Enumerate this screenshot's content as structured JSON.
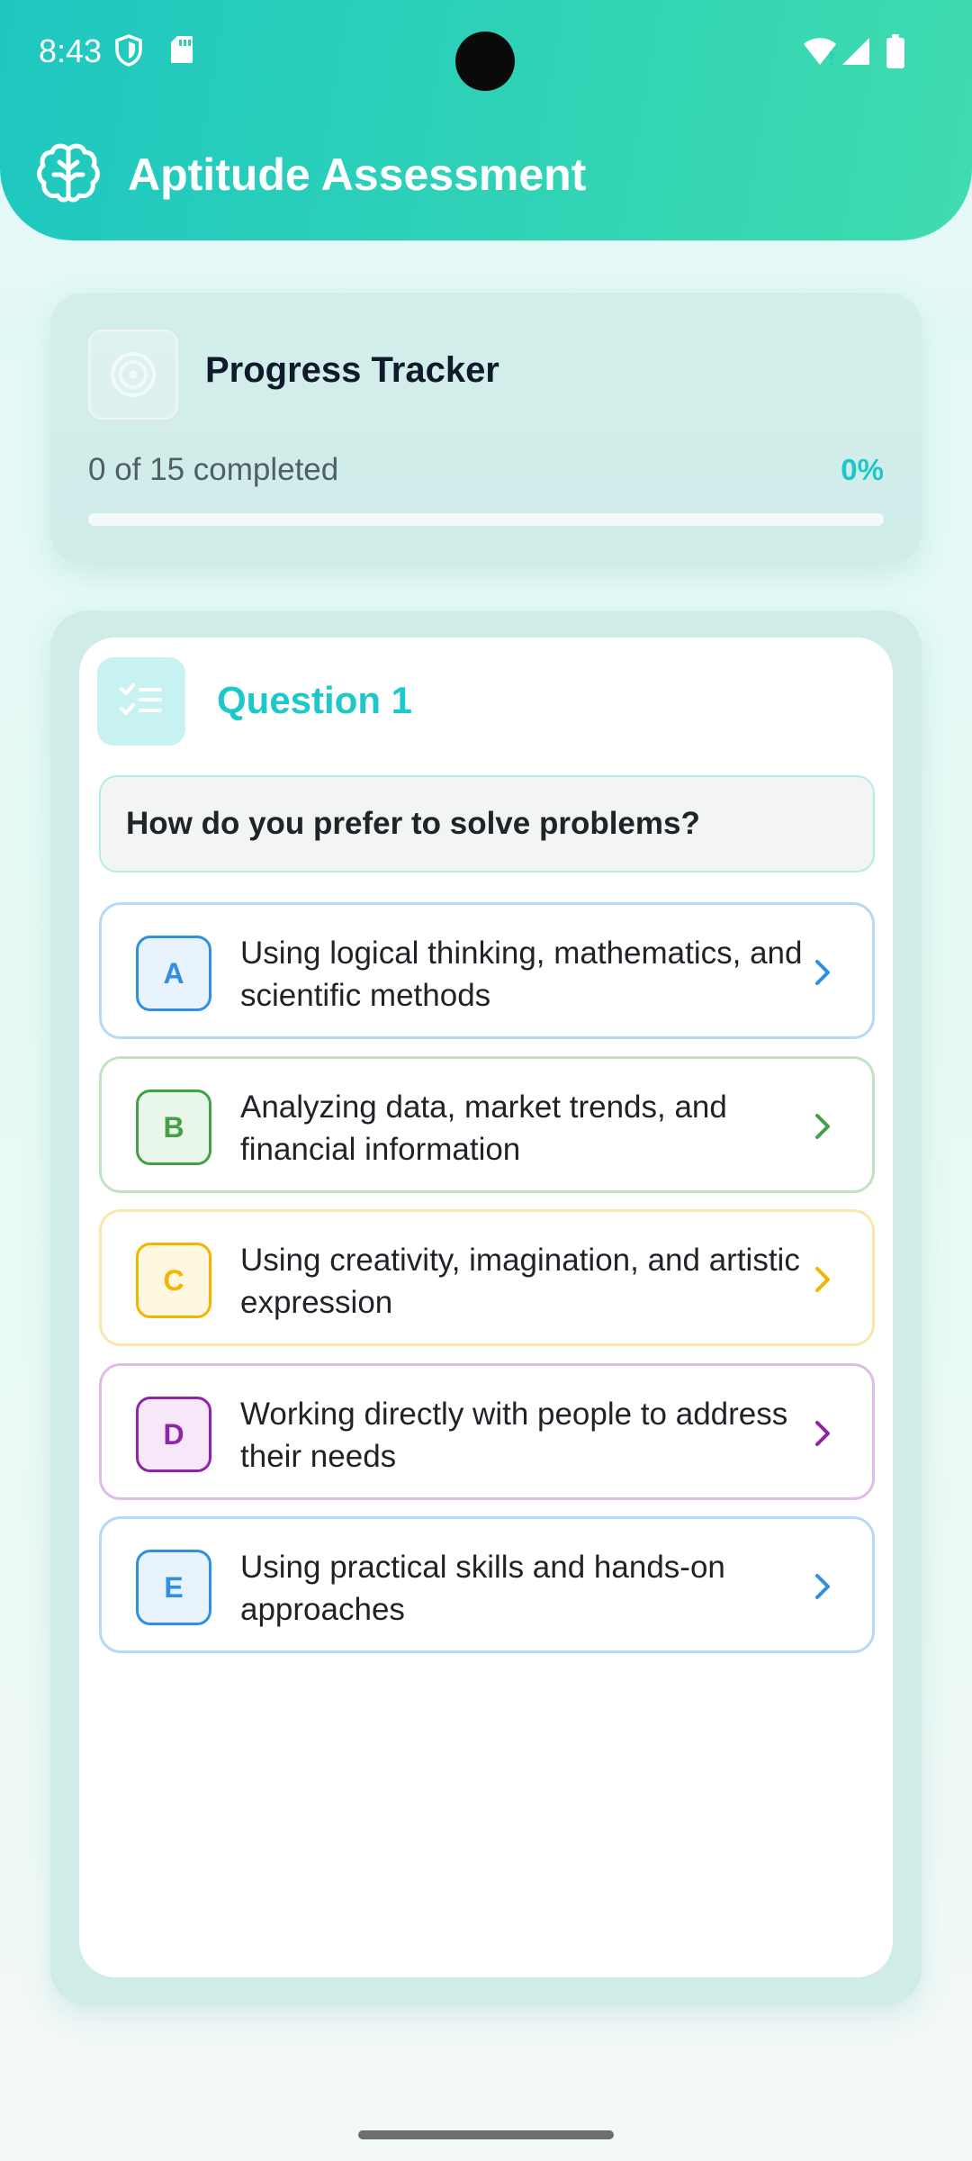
{
  "status_bar": {
    "time": "8:43"
  },
  "app_bar": {
    "title": "Aptitude Assessment",
    "icon": "brain-icon"
  },
  "progress": {
    "title": "Progress Tracker",
    "count_text": "0 of 15 completed",
    "percent_text": "0%",
    "value": 0
  },
  "question": {
    "label": "Question 1",
    "text": "How do you prefer to solve problems?",
    "options": [
      {
        "letter": "A",
        "text": "Using logical thinking, mathematics, and scientific methods",
        "color": "#2f8fe0",
        "bg": "#e9f3fd",
        "border": "#b9d8f5"
      },
      {
        "letter": "B",
        "text": "Analyzing data, market trends, and financial information",
        "color": "#43a047",
        "bg": "#e9f6ea",
        "border": "#c2e3c3"
      },
      {
        "letter": "C",
        "text": "Using creativity, imagination, and artistic expression",
        "color": "#f4b400",
        "bg": "#fff7e0",
        "border": "#fbe7ae"
      },
      {
        "letter": "D",
        "text": "Working directly with people to address their needs",
        "color": "#8e24aa",
        "bg": "#f6e8f9",
        "border": "#dfbce6"
      },
      {
        "letter": "E",
        "text": "Using practical skills and hands-on approaches",
        "color": "#2f8fe0",
        "bg": "#e9f3fd",
        "border": "#b9d8f5"
      }
    ]
  }
}
